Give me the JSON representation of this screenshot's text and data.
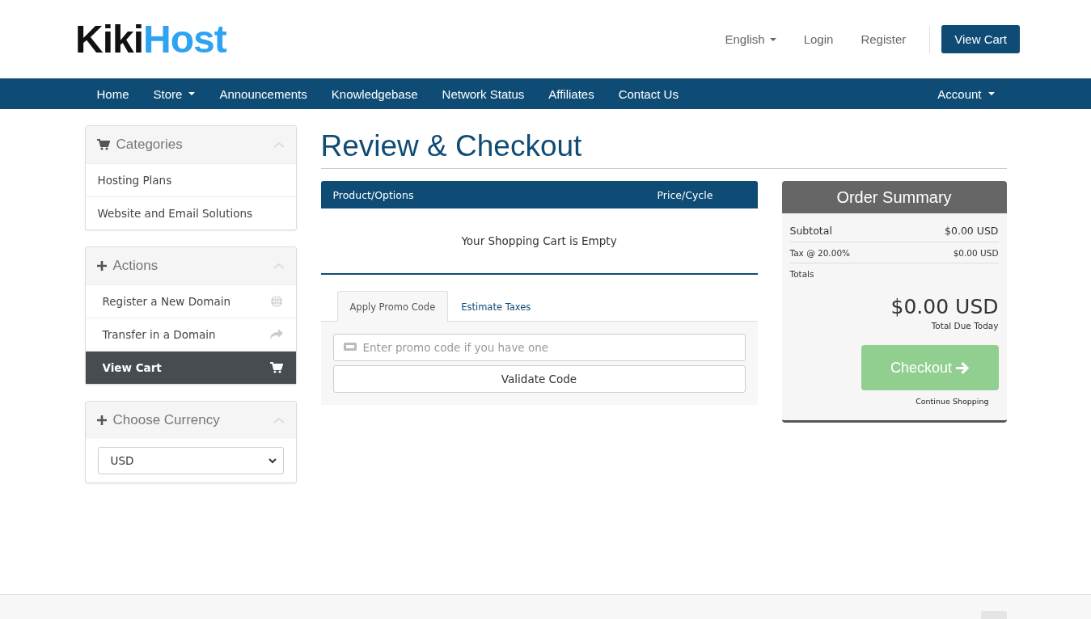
{
  "header": {
    "logo": {
      "part_1": "Kiki",
      "part_2": "Host"
    },
    "links": [
      {
        "label": "English",
        "kind": "dropdown"
      },
      {
        "label": "Login",
        "kind": "link"
      },
      {
        "label": "Register",
        "kind": "link"
      }
    ],
    "cart_button": "View Cart"
  },
  "navbar": {
    "items": [
      {
        "label": "Home",
        "dropdown": false
      },
      {
        "label": "Store",
        "dropdown": true
      },
      {
        "label": "Announcements",
        "dropdown": false
      },
      {
        "label": "Knowledgebase",
        "dropdown": false
      },
      {
        "label": "Network Status",
        "dropdown": false
      },
      {
        "label": "Affiliates",
        "dropdown": false
      },
      {
        "label": "Contact Us",
        "dropdown": false
      }
    ],
    "account": {
      "label": "Account",
      "dropdown": true
    }
  },
  "sidebar": {
    "panels": [
      {
        "title": "Categories",
        "kind": "list",
        "items": [
          {
            "label": "Hosting Plans",
            "selected": false
          },
          {
            "label": "Website and Email Solutions",
            "selected": false
          }
        ]
      },
      {
        "title": "Actions",
        "kind": "list",
        "items": [
          {
            "label": "Register a New Domain",
            "selected": false
          },
          {
            "label": "Transfer in a Domain",
            "selected": false
          },
          {
            "label": "View Cart",
            "selected": true
          }
        ]
      },
      {
        "title": "Choose Currency",
        "kind": "select",
        "value": "USD"
      }
    ]
  },
  "page_title": "Review & Checkout",
  "cart": {
    "columns": [
      "Product/Options",
      "Price/Cycle"
    ],
    "empty_message": "Your Shopping Cart is Empty"
  },
  "promo": {
    "tabs": [
      {
        "label": "Apply Promo Code",
        "selected": true
      },
      {
        "label": "Estimate Taxes",
        "selected": false
      }
    ],
    "placeholder": "Enter promo code if you have one",
    "button": "Validate Code"
  },
  "order_summary": {
    "title": "Order Summary",
    "rows": [
      {
        "label": "Subtotal",
        "value": "$0.00 USD",
        "kind": "main"
      },
      {
        "label": "Tax @ 20.00%",
        "value": "$0.00 USD",
        "kind": "small"
      }
    ],
    "totals_label": "Totals",
    "total": "$0.00 USD",
    "total_caption": "Total Due Today",
    "checkout": {
      "label": "Checkout",
      "disabled": true
    },
    "continue": "Continue Shopping"
  }
}
